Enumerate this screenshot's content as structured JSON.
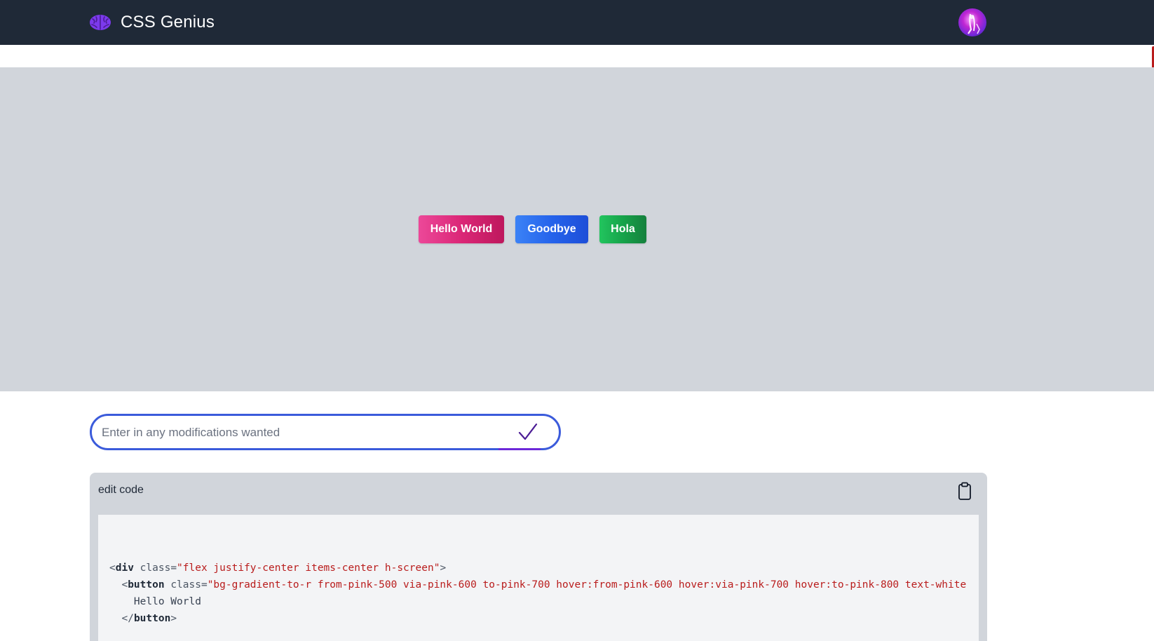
{
  "app": {
    "title": "CSS Genius",
    "logo_icon": "brain-icon",
    "avatar_icon": "user-avatar"
  },
  "preview": {
    "buttons": [
      {
        "label": "Hello World",
        "color": "#db2777"
      },
      {
        "label": "Goodbye",
        "color": "#2563eb"
      },
      {
        "label": "Hola",
        "color": "#16a34a"
      }
    ]
  },
  "modify": {
    "placeholder": "Enter in any modifications wanted",
    "value": "",
    "submit_icon": "checkmark-icon"
  },
  "code": {
    "title": "edit code",
    "copy_icon": "clipboard-icon",
    "lines": [
      {
        "open": "<",
        "tag": "div",
        "attr": " class=",
        "str": "\"flex justify-center items-center h-screen\"",
        "close": ">"
      },
      {
        "open": "<",
        "tag": "button",
        "attr": " class=",
        "str": "\"bg-gradient-to-r from-pink-500 via-pink-600 to-pink-700 hover:from-pink-600 hover:via-pink-700 hover:to-pink-800 text-white",
        "close": ""
      },
      {
        "text": "Hello World"
      },
      {
        "open": "</",
        "tag": "button",
        "close": ">"
      }
    ]
  },
  "colors": {
    "header_bg": "#1f2937",
    "preview_bg": "#d1d5db",
    "input_border": "#3b5bdb",
    "accent": "#6d28d9"
  }
}
